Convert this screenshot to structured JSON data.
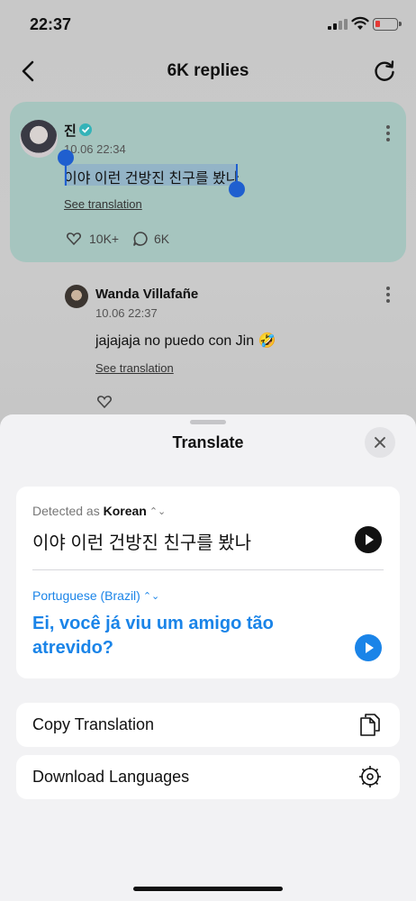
{
  "status_bar": {
    "time": "22:37"
  },
  "nav": {
    "title": "6K replies"
  },
  "post": {
    "author": "진",
    "timestamp": "10.06 22:34",
    "text": "이야 이런 건방진 친구를 봤나",
    "see_translation": "See translation",
    "likes": "10K+",
    "replies": "6K"
  },
  "reply": {
    "author": "Wanda Villafañe",
    "timestamp": "10.06 22:37",
    "text": "jajajaja no puedo con Jin 🤣",
    "see_translation": "See translation"
  },
  "sheet": {
    "title": "Translate",
    "detected_prefix": "Detected as",
    "detected_language": "Korean",
    "source_text": "이야 이런 건방진 친구를 봤나",
    "target_language": "Portuguese (Brazil)",
    "target_text": "Ei, você já viu um amigo tão atrevido?",
    "copy_label": "Copy Translation",
    "download_label": "Download Languages"
  },
  "colors": {
    "accent": "#1a84e8",
    "highlight": "#a6c5bf",
    "verified": "#34b3b8"
  }
}
